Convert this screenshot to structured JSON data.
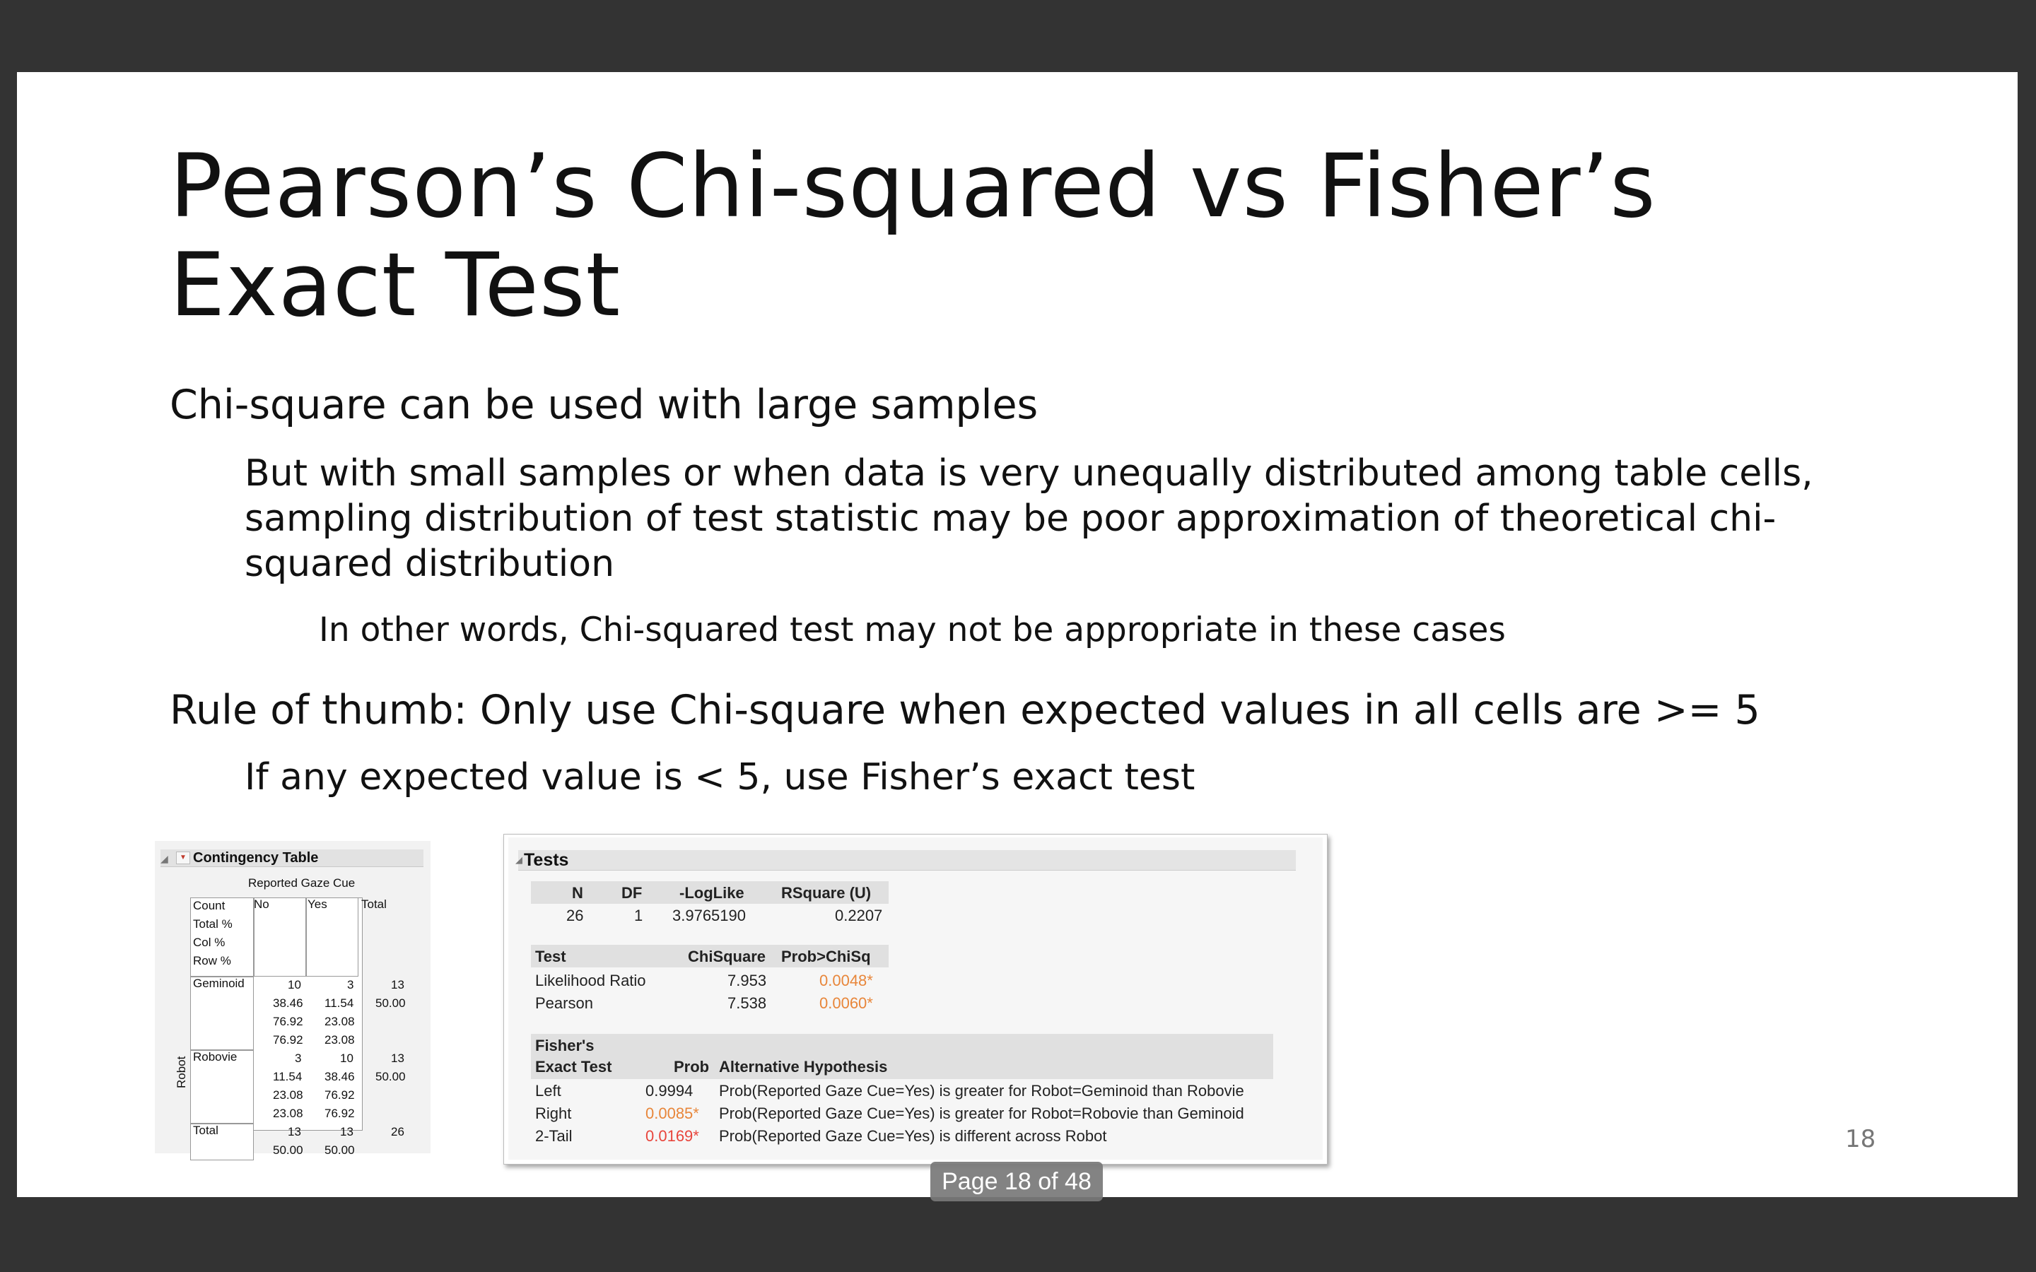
{
  "slide": {
    "title_line_1": "Pearson’s Chi-squared vs Fisher’s",
    "title_line_2": "Exact Test",
    "bullets": {
      "b1": "Chi-square can be used with large samples",
      "b1_sub_line_1": "But with small samples or when data is very unequally distributed among table cells,",
      "b1_sub_line_2": "sampling distribution of test statistic may be poor approximation of theoretical chi-",
      "b1_sub_line_3": "squared distribution",
      "b1_sub_sub": "In other words, Chi-squared test may not be appropriate in these cases",
      "b2": "Rule of thumb: Only use Chi-square when expected values in all cells are >= 5",
      "b2_sub": "If any expected value is < 5, use Fisher’s exact test"
    },
    "slide_number": "18"
  },
  "contingency": {
    "title": "Contingency Table",
    "column_group": "Reported Gaze Cue",
    "row_group": "Robot",
    "col_headers": [
      "No",
      "Yes",
      "Total"
    ],
    "legend": [
      "Count",
      "Total %",
      "Col %",
      "Row %"
    ],
    "rows": [
      {
        "label": "Geminoid",
        "no": [
          "10",
          "38.46",
          "76.92",
          "76.92"
        ],
        "yes": [
          "3",
          "11.54",
          "23.08",
          "23.08"
        ],
        "total": [
          "13",
          "50.00"
        ]
      },
      {
        "label": "Robovie",
        "no": [
          "3",
          "11.54",
          "23.08",
          "23.08"
        ],
        "yes": [
          "10",
          "38.46",
          "76.92",
          "76.92"
        ],
        "total": [
          "13",
          "50.00"
        ]
      }
    ],
    "total_row": {
      "label": "Total",
      "no": [
        "13",
        "50.00"
      ],
      "yes": [
        "13",
        "50.00"
      ],
      "total": "26"
    }
  },
  "tests": {
    "title": "Tests",
    "summary_headers": [
      "N",
      "DF",
      "-LogLike",
      "RSquare (U)"
    ],
    "summary_values": [
      "26",
      "1",
      "3.9765190",
      "0.2207"
    ],
    "chi_headers": [
      "Test",
      "ChiSquare",
      "Prob>ChiSq"
    ],
    "chi_rows": [
      {
        "test": "Likelihood Ratio",
        "chisq": "7.953",
        "prob": "0.0048*"
      },
      {
        "test": "Pearson",
        "chisq": "7.538",
        "prob": "0.0060*"
      }
    ],
    "fisher_header_1": "Fisher's",
    "fisher_headers": [
      "Exact Test",
      "Prob",
      "Alternative Hypothesis"
    ],
    "fisher_rows": [
      {
        "test": "Left",
        "prob": "0.9994",
        "hyp": "Prob(Reported Gaze Cue=Yes) is greater for Robot=Geminoid than Robovie"
      },
      {
        "test": "Right",
        "prob": "0.0085*",
        "hyp": "Prob(Reported Gaze Cue=Yes) is greater for Robot=Robovie than Geminoid"
      },
      {
        "test": "2-Tail",
        "prob": "0.0169*",
        "hyp": "Prob(Reported Gaze Cue=Yes) is different across Robot"
      }
    ]
  },
  "viewer": {
    "page_indicator": "Page 18 of 48"
  },
  "colors": {
    "background": "#333333",
    "slide": "#ffffff",
    "significant_orange": "#e8863a",
    "significant_red": "#e8453c"
  }
}
